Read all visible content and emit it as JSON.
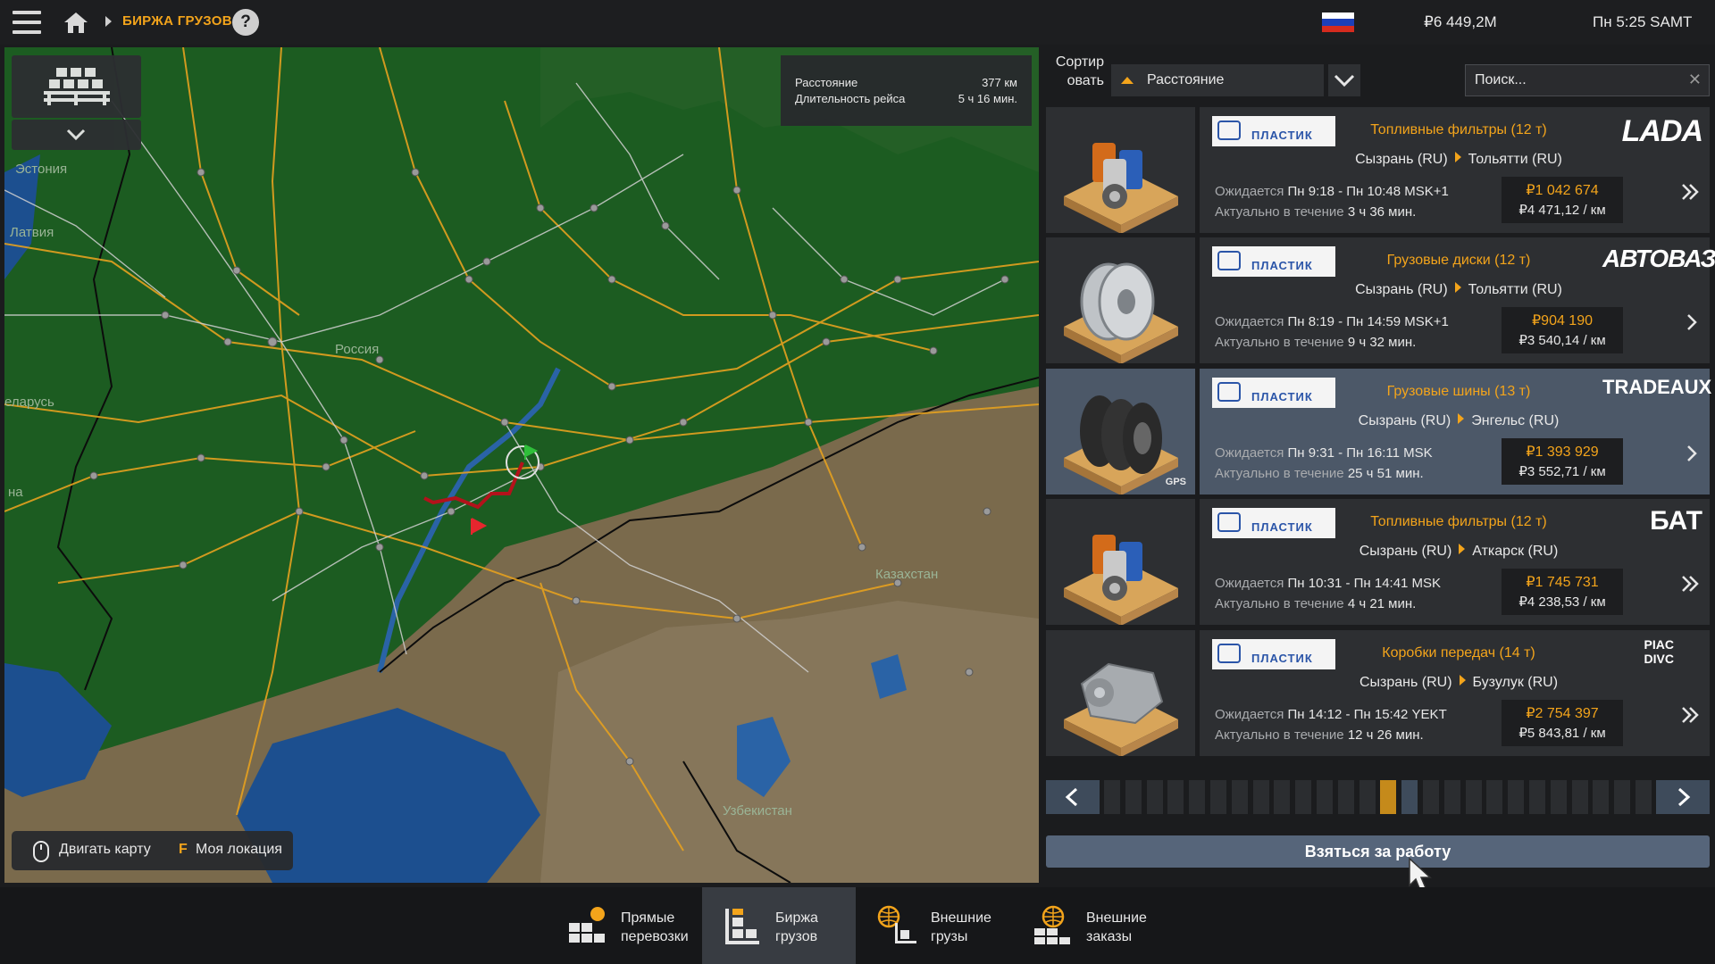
{
  "topbar": {
    "breadcrumb": "БИРЖА ГРУЗОВ",
    "help": "?",
    "money": "₽6 449,2M",
    "clock": "Пн 5:25 SAMT"
  },
  "map": {
    "labels": [
      "Эстония",
      "Латвия",
      "Россия",
      "еларусь",
      "на",
      "Казахстан",
      "Узбекистан"
    ],
    "route_info": {
      "distance_label": "Расстояние",
      "distance_value": "377 км",
      "duration_label": "Длительность рейса",
      "duration_value": "5 ч 16 мин."
    },
    "hint_move": "Двигать карту",
    "hint_key": "F",
    "hint_location": "Моя локация"
  },
  "sort": {
    "label": "Сортир\nовать",
    "value": "Расстояние"
  },
  "search": {
    "placeholder": "Поиск..."
  },
  "jobs": [
    {
      "company": "ПЛАСТИК",
      "cargo": "Топливные фильтры (12 т)",
      "from": "Сызрань (RU)",
      "to": "Тольятти (RU)",
      "expected_label": "Ожидается",
      "expected": "Пн 9:18 - Пн 10:48 MSK+1",
      "valid_label": "Актуально в течение",
      "valid": "3 ч 36 мин.",
      "price": "₽1 042 674",
      "per_km": "₽4 471,12 / км",
      "brand": "LADA",
      "icon": "double-chevron-icon",
      "selected": false
    },
    {
      "company": "ПЛАСТИК",
      "cargo": "Грузовые диски (12 т)",
      "from": "Сызрань (RU)",
      "to": "Тольятти (RU)",
      "expected_label": "Ожидается",
      "expected": "Пн 8:19 - Пн 14:59 MSK+1",
      "valid_label": "Актуально в течение",
      "valid": "9 ч 32 мин.",
      "price": "₽904 190",
      "per_km": "₽3 540,14 / км",
      "brand": "АВТОВАЗ",
      "icon": "single-chevron-icon",
      "selected": false
    },
    {
      "company": "ПЛАСТИК",
      "cargo": "Грузовые шины (13 т)",
      "from": "Сызрань (RU)",
      "to": "Энгельс (RU)",
      "expected_label": "Ожидается",
      "expected": "Пн 9:31 - Пн 16:11 MSK",
      "valid_label": "Актуально в течение",
      "valid": "25 ч 51 мин.",
      "price": "₽1 393 929",
      "per_km": "₽3 552,71 / км",
      "brand": "TRADEAUX",
      "icon": "single-chevron-icon",
      "gps": "GPS",
      "selected": true
    },
    {
      "company": "ПЛАСТИК",
      "cargo": "Топливные фильтры (12 т)",
      "from": "Сызрань (RU)",
      "to": "Аткарск (RU)",
      "expected_label": "Ожидается",
      "expected": "Пн 10:31 - Пн 14:41 MSK",
      "valid_label": "Актуально в течение",
      "valid": "4 ч 21 мин.",
      "price": "₽1 745 731",
      "per_km": "₽4 238,53 / км",
      "brand": "БАТ",
      "icon": "double-chevron-icon",
      "selected": false
    },
    {
      "company": "ПЛАСТИК",
      "cargo": "Коробки передач (14 т)",
      "from": "Сызрань (RU)",
      "to": "Бузулук (RU)",
      "expected_label": "Ожидается",
      "expected": "Пн 14:12 - Пн 15:42 YEKT",
      "valid_label": "Актуально в течение",
      "valid": "12 ч 26 мин.",
      "price": "₽2 754 397",
      "per_km": "₽5 843,81 / км",
      "brand": "PIAC DIVC",
      "icon": "double-chevron-icon",
      "selected": false
    }
  ],
  "pager": {
    "pages": 26,
    "current": 13
  },
  "take_button": "Взяться за работу",
  "tabs": [
    {
      "label": "Прямые\nперевозки",
      "active": false
    },
    {
      "label": "Биржа\nгрузов",
      "active": true
    },
    {
      "label": "Внешние\nгрузы",
      "active": false
    },
    {
      "label": "Внешние\nзаказы",
      "active": false
    }
  ],
  "colors": {
    "accent": "#f3a41b",
    "selected": "#4c5868",
    "panel": "#2d2f32"
  }
}
